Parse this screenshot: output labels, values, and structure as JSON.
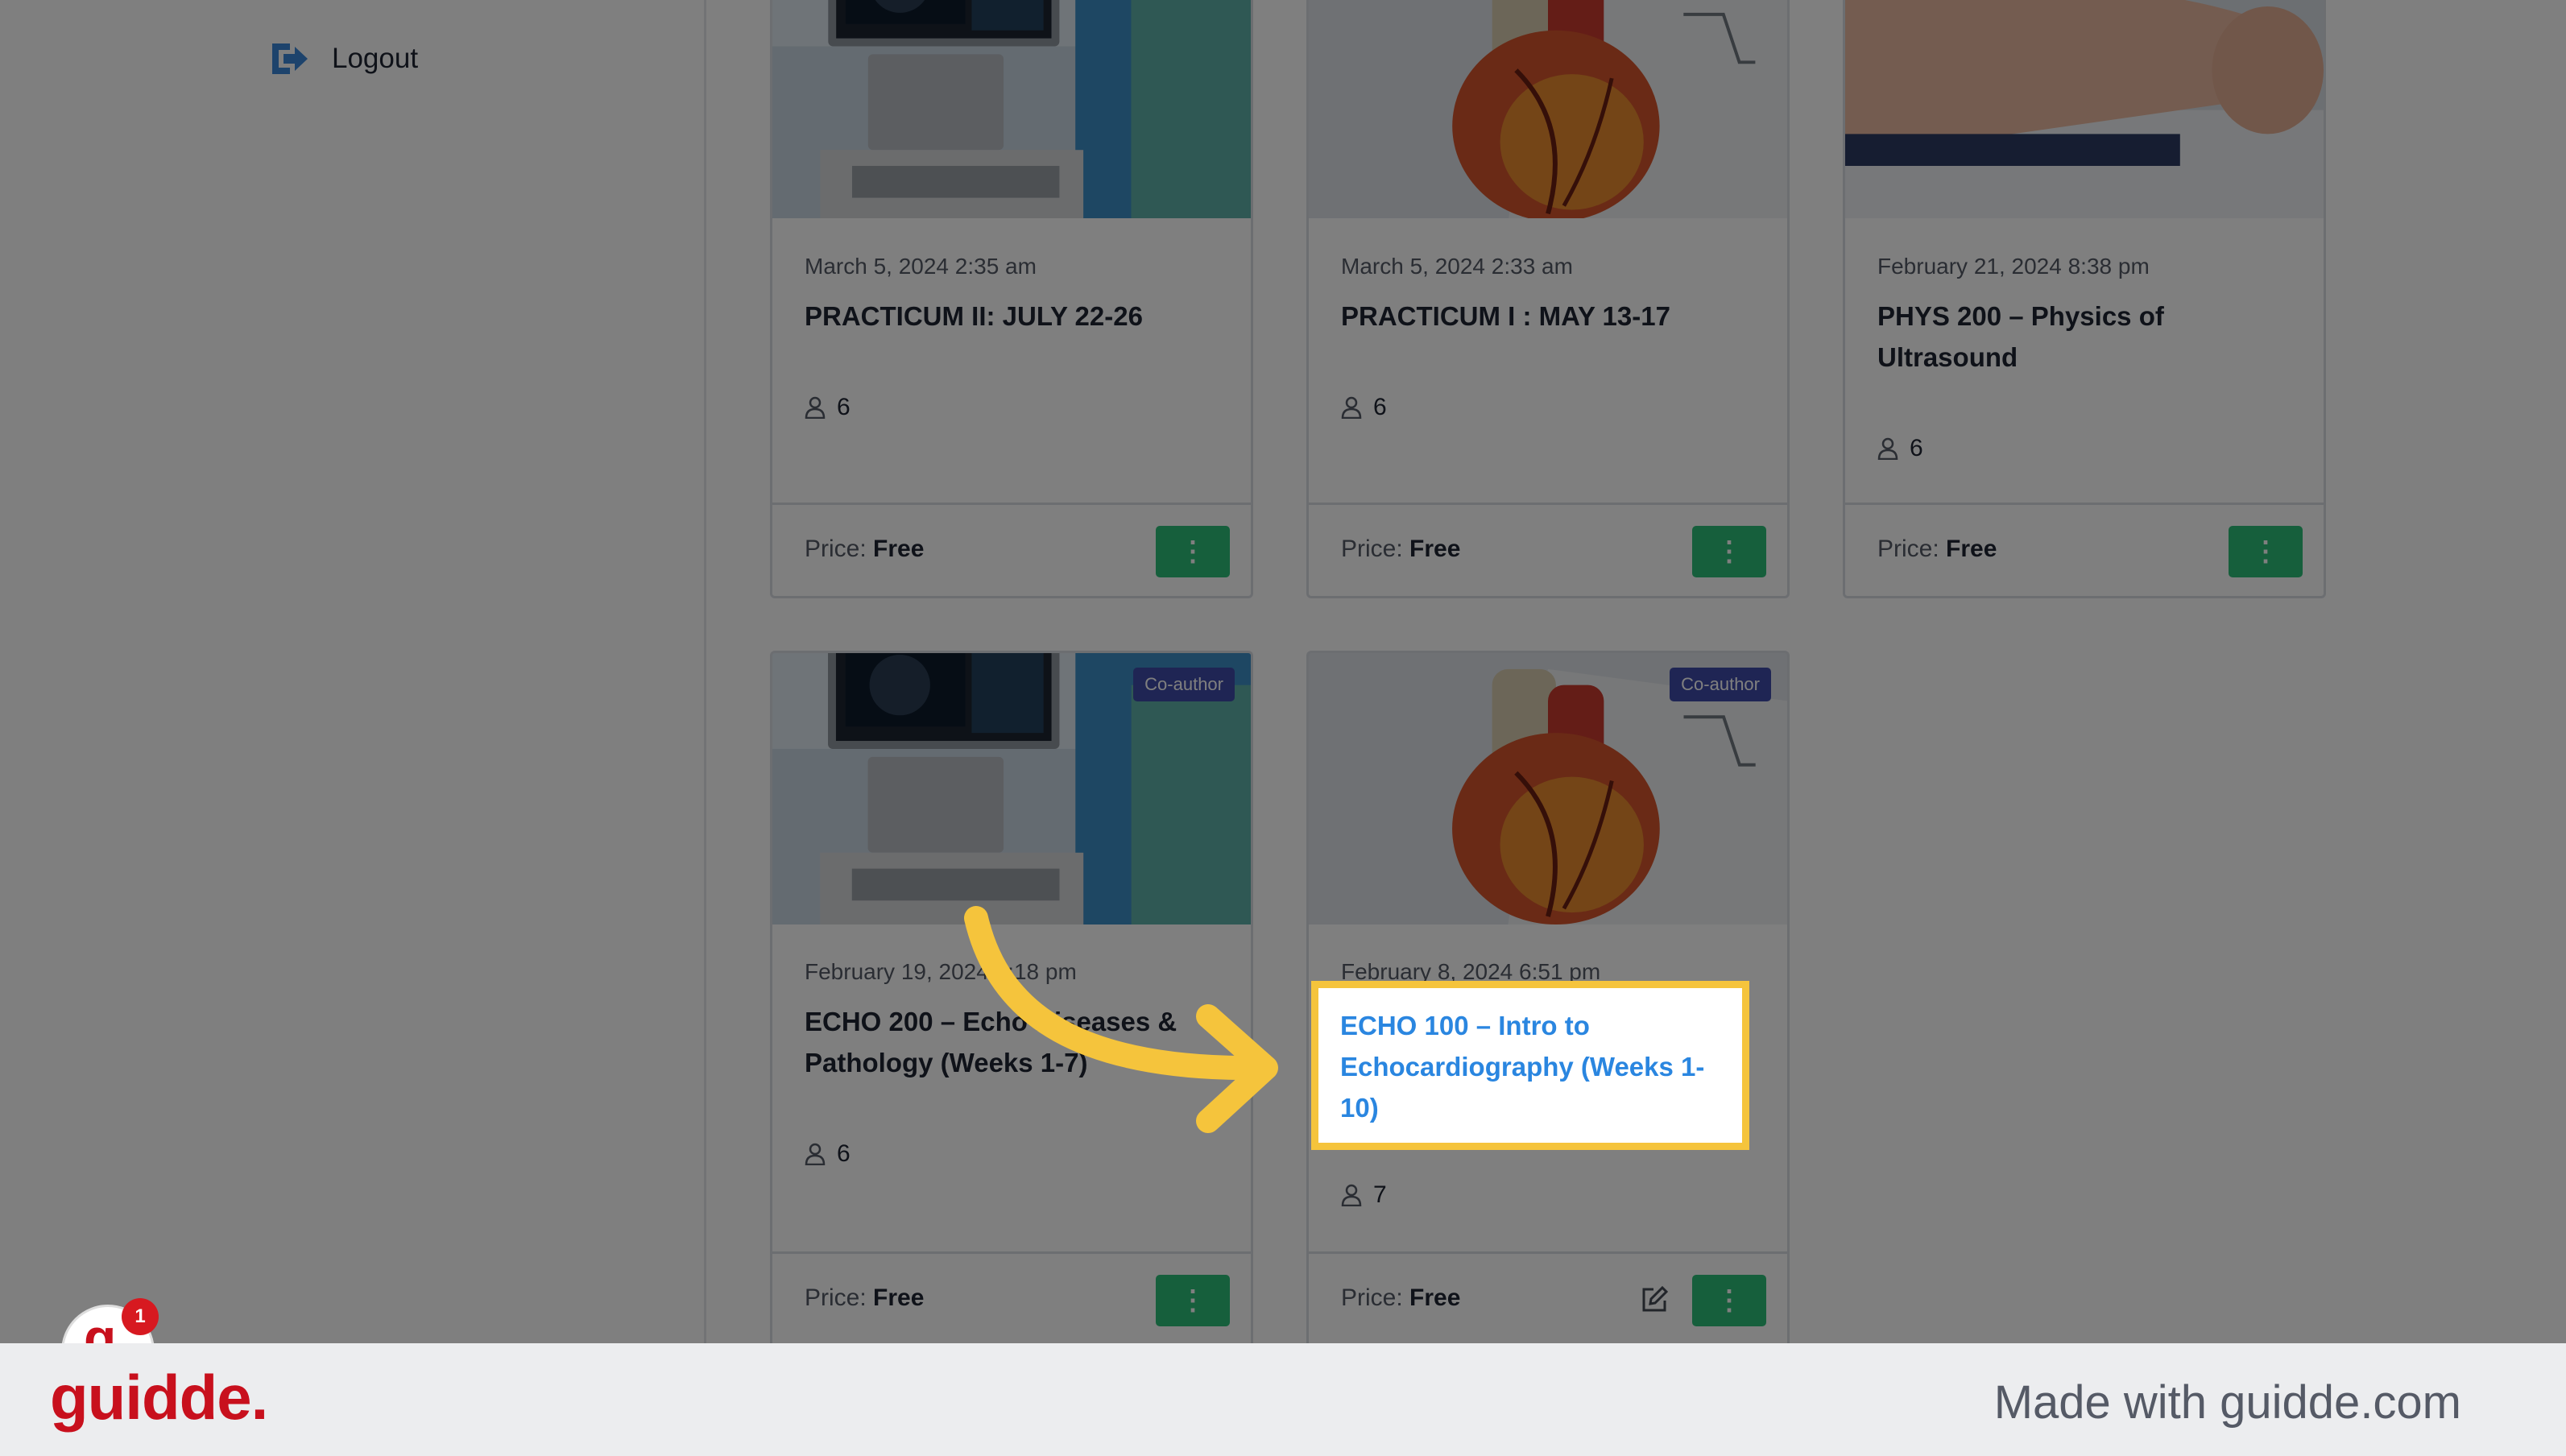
{
  "sidebar": {
    "logout_label": "Logout"
  },
  "price_label": "Price:",
  "courses": [
    {
      "date": "March 5, 2024 2:35 am",
      "title": "PRACTICUM II: JULY 22-26",
      "students": "6",
      "price": "Free",
      "badge": "",
      "image": "ultrasound-machine"
    },
    {
      "date": "March 5, 2024 2:33 am",
      "title": "PRACTICUM I : MAY 13-17",
      "students": "6",
      "price": "Free",
      "badge": "",
      "image": "heart-model"
    },
    {
      "date": "February 21, 2024 8:38 pm",
      "title": "PHYS 200 – Physics of Ultrasound",
      "students": "6",
      "price": "Free",
      "badge": "",
      "image": "patient-scan"
    },
    {
      "date": "February 19, 2024 4:18 pm",
      "title": "ECHO 200 – Echo Diseases & Pathology (Weeks 1-7)",
      "students": "6",
      "price": "Free",
      "badge": "Co-author",
      "image": "ultrasound-machine"
    },
    {
      "date": "February 8, 2024 6:51 pm",
      "title": "ECHO 100 – Intro to Echocardiography (Weeks 1-10)",
      "students": "7",
      "price": "Free",
      "badge": "Co-author",
      "image": "heart-model"
    }
  ],
  "menu_glyph": "⋮",
  "widget": {
    "letter": "g",
    "notifications": "1"
  },
  "banner": {
    "brand": "guidde.",
    "made_with": "Made with guidde.com"
  },
  "colors": {
    "accent_green": "#2dbf78",
    "badge_blue": "#3f4aa8",
    "highlight_yellow": "#f5c43c",
    "link_blue": "#2a86e0",
    "brand_red": "#c8101d"
  }
}
